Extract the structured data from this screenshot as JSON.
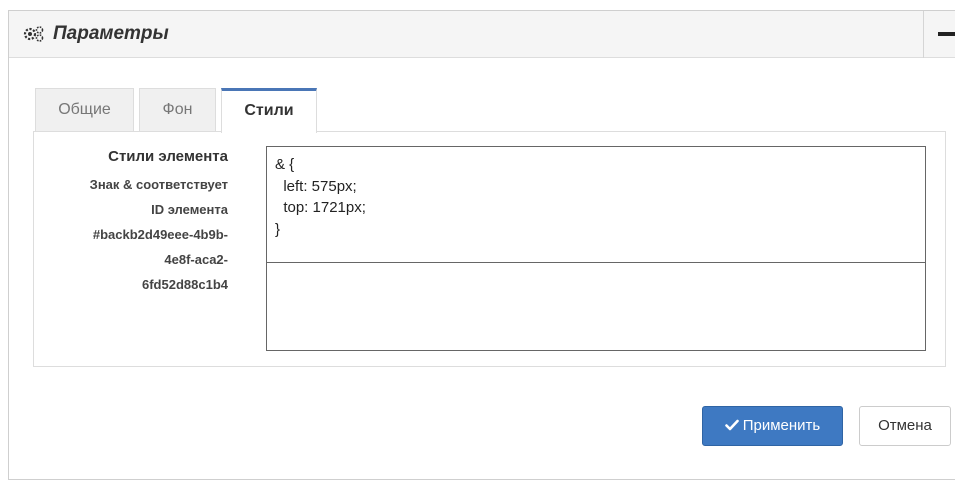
{
  "panel": {
    "title": "Параметры",
    "header_icon": "gears-icon",
    "collapse_icon": "minus-icon"
  },
  "tabs": [
    {
      "label": "Общие",
      "active": false
    },
    {
      "label": "Фон",
      "active": false
    },
    {
      "label": "Стили",
      "active": true
    }
  ],
  "styles_tab": {
    "label_main": "Стили элемента",
    "hint_lines": [
      "Знак & соответствует",
      "ID элемента",
      "#backb2d49eee-4b9b-",
      "4e8f-aca2-",
      "6fd52d88c1b4"
    ],
    "code_lines": [
      "& {",
      "  left: 575px;",
      "  top: 1721px;",
      "}"
    ]
  },
  "buttons": {
    "apply_label": "Применить",
    "apply_icon": "check-icon",
    "cancel_label": "Отмена"
  },
  "colors": {
    "accent": "#3e79c2",
    "tab_active_border": "#4a76b6",
    "header_bg": "#f5f5f5"
  }
}
